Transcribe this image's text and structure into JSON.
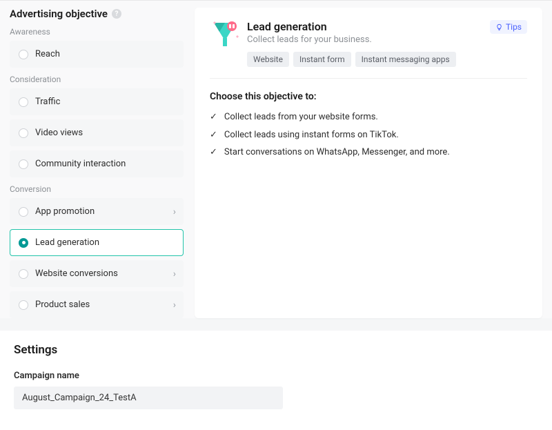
{
  "sidebar": {
    "title": "Advertising objective",
    "groups": [
      {
        "label": "Awareness",
        "items": [
          {
            "label": "Reach",
            "chevron": false,
            "selected": false
          }
        ]
      },
      {
        "label": "Consideration",
        "items": [
          {
            "label": "Traffic",
            "chevron": false,
            "selected": false
          },
          {
            "label": "Video views",
            "chevron": false,
            "selected": false
          },
          {
            "label": "Community interaction",
            "chevron": false,
            "selected": false
          }
        ]
      },
      {
        "label": "Conversion",
        "items": [
          {
            "label": "App promotion",
            "chevron": true,
            "selected": false
          },
          {
            "label": "Lead generation",
            "chevron": false,
            "selected": true
          },
          {
            "label": "Website conversions",
            "chevron": true,
            "selected": false
          },
          {
            "label": "Product sales",
            "chevron": true,
            "selected": false
          }
        ]
      }
    ]
  },
  "detail": {
    "title": "Lead generation",
    "subtitle": "Collect leads for your business.",
    "tags": [
      "Website",
      "Instant form",
      "Instant messaging apps"
    ],
    "tips_label": "Tips",
    "choose_title": "Choose this objective to:",
    "benefits": [
      "Collect leads from your website forms.",
      "Collect leads using instant forms on TikTok.",
      "Start conversations on WhatsApp, Messenger, and more."
    ]
  },
  "settings": {
    "title": "Settings",
    "campaign_name_label": "Campaign name",
    "campaign_name_value": "August_Campaign_24_TestA"
  }
}
